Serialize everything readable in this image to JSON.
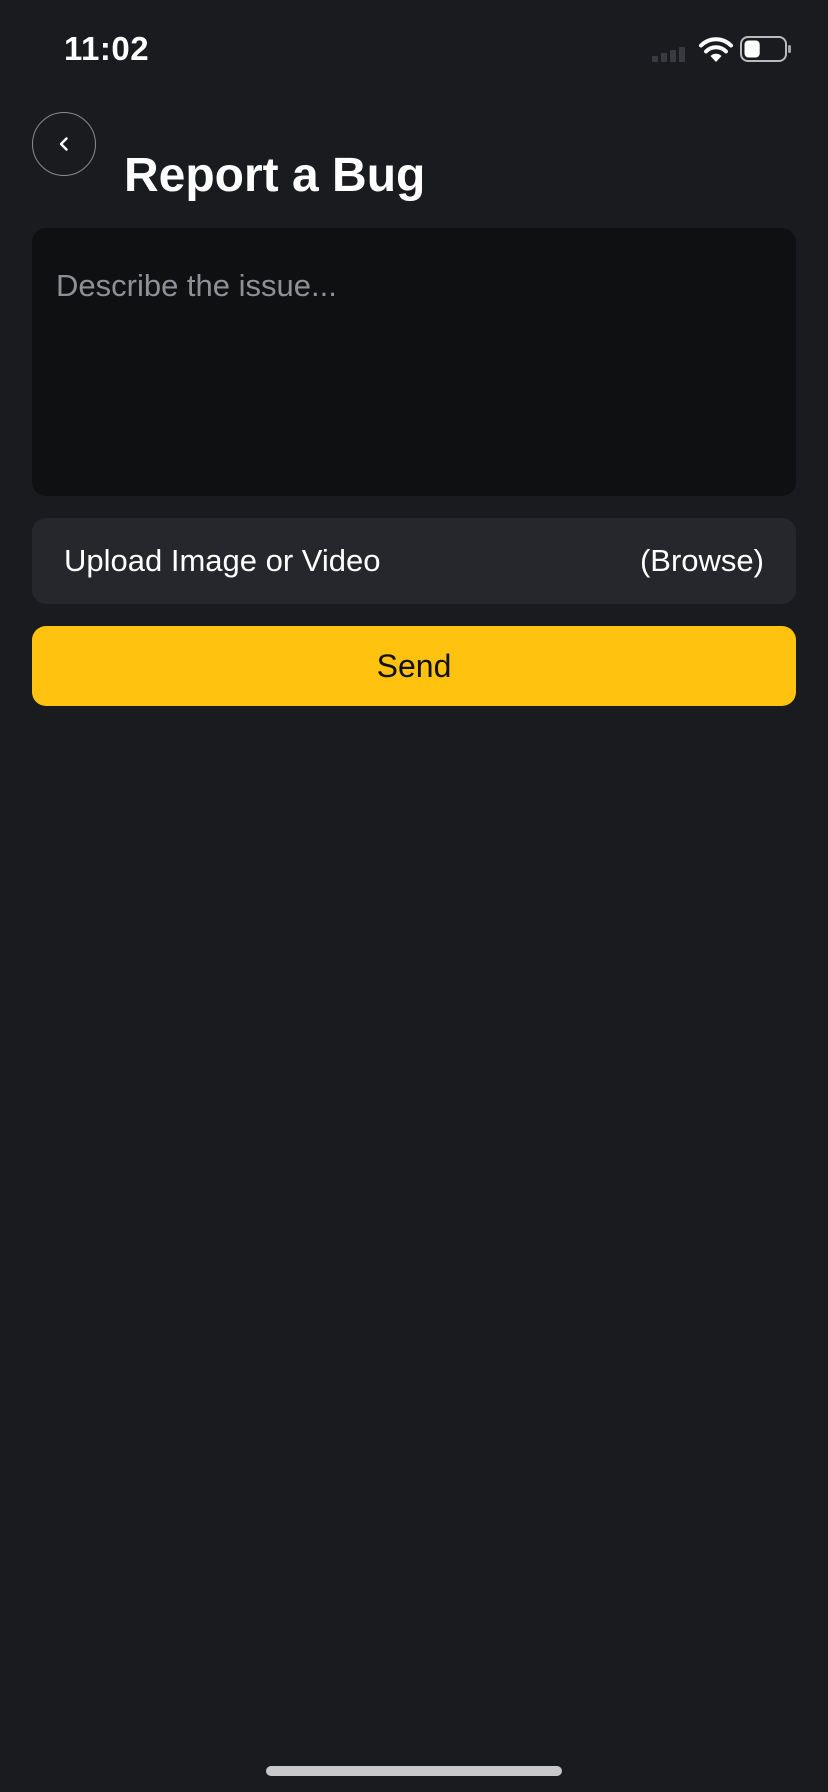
{
  "status_bar": {
    "time": "11:02",
    "battery_level_percent": 40
  },
  "header": {
    "title": "Report a Bug",
    "back_icon": "chevron-left-icon"
  },
  "form": {
    "description_placeholder": "Describe the issue...",
    "description_value": "",
    "upload_label": "Upload Image or Video",
    "browse_label": "(Browse)",
    "send_label": "Send"
  },
  "colors": {
    "background": "#1a1b1f",
    "input_background": "#0f1012",
    "upload_background": "#26272c",
    "accent": "#ffc20e",
    "placeholder": "#8e9096"
  }
}
